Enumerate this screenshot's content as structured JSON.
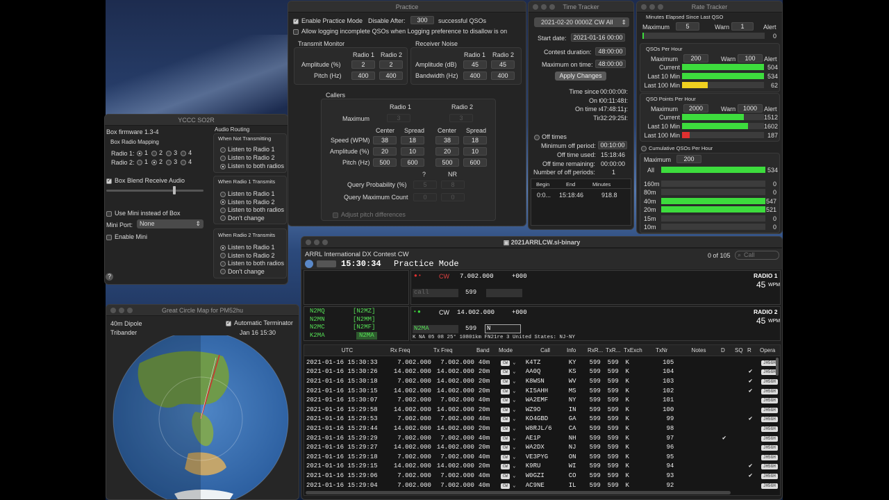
{
  "practice": {
    "title": "Practice",
    "enable_label": "Enable Practice Mode",
    "disable_after_label": "Disable After:",
    "disable_after_value": "300",
    "successful_label": "successful QSOs",
    "allow_label": "Allow logging incomplete QSOs when Logging preference to disallow is on",
    "tx_monitor": "Transmit Monitor",
    "rx_noise": "Receiver Noise",
    "radio1": "Radio 1",
    "radio2": "Radio 2",
    "amplitude_pct": "Amplitude (%)",
    "pitch_hz": "Pitch (Hz)",
    "amplitude_db": "Amplitude (dB)",
    "bandwidth_hz": "Bandwidth (Hz)",
    "tx_amp": [
      "2",
      "2"
    ],
    "tx_pitch": [
      "400",
      "400"
    ],
    "rx_amp": [
      "45",
      "45"
    ],
    "rx_bw": [
      "400",
      "400"
    ],
    "callers": "Callers",
    "maximum": "Maximum",
    "max_vals": [
      "3",
      "3"
    ],
    "center": "Center",
    "spread": "Spread",
    "speed_wpm": "Speed (WPM)",
    "speed": [
      "38",
      "18",
      "38",
      "18"
    ],
    "amp": [
      "20",
      "10",
      "20",
      "10"
    ],
    "pitch": [
      "500",
      "600",
      "500",
      "600"
    ],
    "q": "?",
    "nr": "NR",
    "query_prob": "Query Probability (%)",
    "query_prob_vals": [
      "5",
      "8"
    ],
    "query_max": "Query Maximum Count",
    "query_max_vals": [
      "0",
      "0"
    ],
    "adjust_label": "Adjust pitch differences"
  },
  "time_tracker": {
    "title": "Time Tracker",
    "select": "2021-02-20 0000Z CW All",
    "start_date_label": "Start date:",
    "start_date": "2021-01-16 00:00",
    "duration_label": "Contest duration:",
    "duration": "48:00:00",
    "max_on_label": "Maximum on time:",
    "max_on": "48:00:00",
    "apply": "Apply Changes",
    "since_label": "Time since last QSO:",
    "since": "00:00:00",
    "on_used_label": "On time used:",
    "on_used": "00:11:48",
    "on_rem_label": "On time remaining:",
    "on_rem": "47:48:11",
    "to_end_label": "Time to end:",
    "to_end": "32:29:25",
    "off_times": "Off times",
    "min_off_label": "Minimum off period:",
    "min_off": "00:10:00",
    "off_used_label": "Off time used:",
    "off_used": "15:18:46",
    "off_rem_label": "Off time remaining:",
    "off_rem": "00:00:00",
    "num_off_label": "Number of off periods:",
    "num_off": "1",
    "col_begin": "Begin",
    "col_end": "End",
    "col_minutes": "Minutes",
    "row_begin": "0:0...",
    "row_end": "15:18:46",
    "row_minutes": "918.8"
  },
  "rate": {
    "title": "Rate Tracker",
    "s1_title": "Minutes Elapsed Since Last QSO",
    "maximum": "Maximum",
    "warn": "Warn",
    "alert": "Alert",
    "s1_max": "5",
    "s1_warn": "1",
    "s1_value": "0",
    "s1_fill": 0.01,
    "s2_title": "QSOs Per Hour",
    "s2_max": "200",
    "s2_warn": "100",
    "s2_rows": [
      {
        "label": "Current",
        "value": "504",
        "fill": 1.0,
        "color": "#3ddc3d"
      },
      {
        "label": "Last 10 Min",
        "value": "534",
        "fill": 1.0,
        "color": "#3ddc3d"
      },
      {
        "label": "Last 100 Min",
        "value": "62",
        "fill": 0.31,
        "color": "#f0d020"
      }
    ],
    "s3_title": "QSO Points Per Hour",
    "s3_max": "2000",
    "s3_warn": "1000",
    "s3_rows": [
      {
        "label": "Current",
        "value": "1512",
        "fill": 0.756,
        "color": "#3ddc3d"
      },
      {
        "label": "Last 10 Min",
        "value": "1602",
        "fill": 0.801,
        "color": "#3ddc3d"
      },
      {
        "label": "Last 100 Min",
        "value": "187",
        "fill": 0.094,
        "color": "#e03030"
      }
    ],
    "s4_title": "Cumulative QSOs Per Hour",
    "s4_max": "200",
    "all_label": "All",
    "all_value": "534",
    "bands": [
      {
        "label": "160m",
        "value": "0",
        "fill": 0.0
      },
      {
        "label": "80m",
        "value": "0",
        "fill": 0.0
      },
      {
        "label": "40m",
        "value": "547",
        "fill": 1.0
      },
      {
        "label": "20m",
        "value": "521",
        "fill": 1.0
      },
      {
        "label": "15m",
        "value": "0",
        "fill": 0.0
      },
      {
        "label": "10m",
        "value": "0",
        "fill": 0.0
      }
    ]
  },
  "ycc": {
    "title": "YCCC SO2R",
    "firmware": "Box firmware 1.3-4",
    "mapping": "Box Radio Mapping",
    "radio1": "Radio 1:",
    "radio2": "Radio 2:",
    "opts": [
      "1",
      "2",
      "3",
      "4"
    ],
    "blend": "Box Blend Receive Audio",
    "use_mini": "Use Mini instead of Box",
    "mini_port": "Mini Port:",
    "mini_port_value": "None",
    "enable_mini": "Enable Mini",
    "routing": "Audio Routing",
    "not_tx": "When Not Transmitting",
    "not_tx_opts": [
      "Listen to Radio 1",
      "Listen to Radio 2",
      "Listen to both radios"
    ],
    "r1_tx": "When Radio 1 Transmits",
    "r2_tx": "When Radio 2 Transmits",
    "tx_opts": [
      "Listen to Radio 1",
      "Listen to Radio 2",
      "Listen to both radios",
      "Don't change"
    ],
    "help": "?"
  },
  "map": {
    "title": "Great Circle Map for PM52hu",
    "antenna1": "40m Dipole",
    "antenna2": "Tribander",
    "terminator": "Automatic Terminator",
    "date": "Jan 16 15:30"
  },
  "main": {
    "title": "2021ARRLCW.sl-binary",
    "contest": "ARRL International DX Contest CW",
    "count": "0 of 105",
    "search_placeholder": "Call",
    "clock": "15:30:34",
    "mode": "Practice Mode",
    "r1": {
      "mode": "CW",
      "freq": "7.002.000",
      "offset": "+000",
      "call_placeholder": "call",
      "rst": "599",
      "label": "RADIO 1",
      "wpm": "45",
      "wpm_unit": "WPM"
    },
    "r2": {
      "mode": "CW",
      "freq": "14.002.000",
      "offset": "+000",
      "call": "N2MA",
      "rst": "599",
      "exch": "N",
      "label": "RADIO 2",
      "wpm": "45",
      "wpm_unit": "WPM"
    },
    "bandmap_left": [
      "N2MQ",
      "N2MN",
      "N2MC",
      "K2MA"
    ],
    "bandmap_right": [
      "[N2MZ]",
      "[N2MM]",
      "[N2MF]",
      "N2MA"
    ],
    "info_line": "K NA 05 08 25° 10801km FN21re 3 United States: NJ-NY",
    "headers": [
      "UTC",
      "Rx Freq",
      "Tx Freq",
      "Band",
      "Mode",
      "Call",
      "Info",
      "RxR...",
      "TxR...",
      "TxExch",
      "TxNr",
      "Notes",
      "D",
      "SQ",
      "R",
      "Opera"
    ],
    "rows": [
      [
        "2021-01-16 15:30:33",
        "7.002.000",
        "7.002.000",
        "40m",
        "CW",
        "K4TZ",
        "KY",
        "599",
        "599",
        "K",
        "105",
        "",
        "",
        "",
        "",
        "JH5GH"
      ],
      [
        "2021-01-16 15:30:26",
        "14.002.000",
        "14.002.000",
        "20m",
        "CW",
        "AA0Q",
        "KS",
        "599",
        "599",
        "K",
        "104",
        "",
        "",
        "",
        "✔",
        "JH5GH"
      ],
      [
        "2021-01-16 15:30:18",
        "7.002.000",
        "14.002.000",
        "20m",
        "CW",
        "K8WSN",
        "WV",
        "599",
        "599",
        "K",
        "103",
        "",
        "",
        "",
        "✔",
        "JH5GH"
      ],
      [
        "2021-01-16 15:30:15",
        "14.002.000",
        "14.002.000",
        "20m",
        "CW",
        "KI5AHH",
        "MS",
        "599",
        "599",
        "K",
        "102",
        "",
        "",
        "",
        "✔",
        "JH5GH"
      ],
      [
        "2021-01-16 15:30:07",
        "7.002.000",
        "7.002.000",
        "40m",
        "CW",
        "WA2EMF",
        "NY",
        "599",
        "599",
        "K",
        "101",
        "",
        "",
        "",
        "",
        "JH5GH"
      ],
      [
        "2021-01-16 15:29:58",
        "14.002.000",
        "14.002.000",
        "20m",
        "CW",
        "WZ9O",
        "IN",
        "599",
        "599",
        "K",
        "100",
        "",
        "",
        "",
        "",
        "JH5GH"
      ],
      [
        "2021-01-16 15:29:53",
        "7.002.000",
        "7.002.000",
        "40m",
        "CW",
        "KO4GBD",
        "GA",
        "599",
        "599",
        "K",
        "99",
        "",
        "",
        "",
        "✔",
        "JH5GH"
      ],
      [
        "2021-01-16 15:29:44",
        "14.002.000",
        "14.002.000",
        "20m",
        "CW",
        "W8RJL/6",
        "CA",
        "599",
        "599",
        "K",
        "98",
        "",
        "",
        "",
        "",
        "JH5GH"
      ],
      [
        "2021-01-16 15:29:29",
        "7.002.000",
        "7.002.000",
        "40m",
        "CW",
        "AE1P",
        "NH",
        "599",
        "599",
        "K",
        "97",
        "",
        "✔",
        "",
        "",
        "JH5GH"
      ],
      [
        "2021-01-16 15:29:27",
        "14.002.000",
        "14.002.000",
        "20m",
        "CW",
        "WA2DX",
        "NJ",
        "599",
        "599",
        "K",
        "96",
        "",
        "",
        "",
        "",
        "JH5GH"
      ],
      [
        "2021-01-16 15:29:18",
        "7.002.000",
        "7.002.000",
        "40m",
        "CW",
        "VE3PYG",
        "ON",
        "599",
        "599",
        "K",
        "95",
        "",
        "",
        "",
        "",
        "JH5GH"
      ],
      [
        "2021-01-16 15:29:15",
        "14.002.000",
        "14.002.000",
        "20m",
        "CW",
        "K9RU",
        "WI",
        "599",
        "599",
        "K",
        "94",
        "",
        "",
        "",
        "✔",
        "JH5GH"
      ],
      [
        "2021-01-16 15:29:06",
        "7.002.000",
        "7.002.000",
        "40m",
        "CW",
        "W0GZI",
        "CO",
        "599",
        "599",
        "K",
        "93",
        "",
        "",
        "",
        "✔",
        "JH5GH"
      ],
      [
        "2021-01-16 15:29:04",
        "7.002.000",
        "7.002.000",
        "40m",
        "CW",
        "AC9NE",
        "IL",
        "599",
        "599",
        "K",
        "92",
        "",
        "",
        "",
        "",
        "JH5GH"
      ]
    ]
  }
}
